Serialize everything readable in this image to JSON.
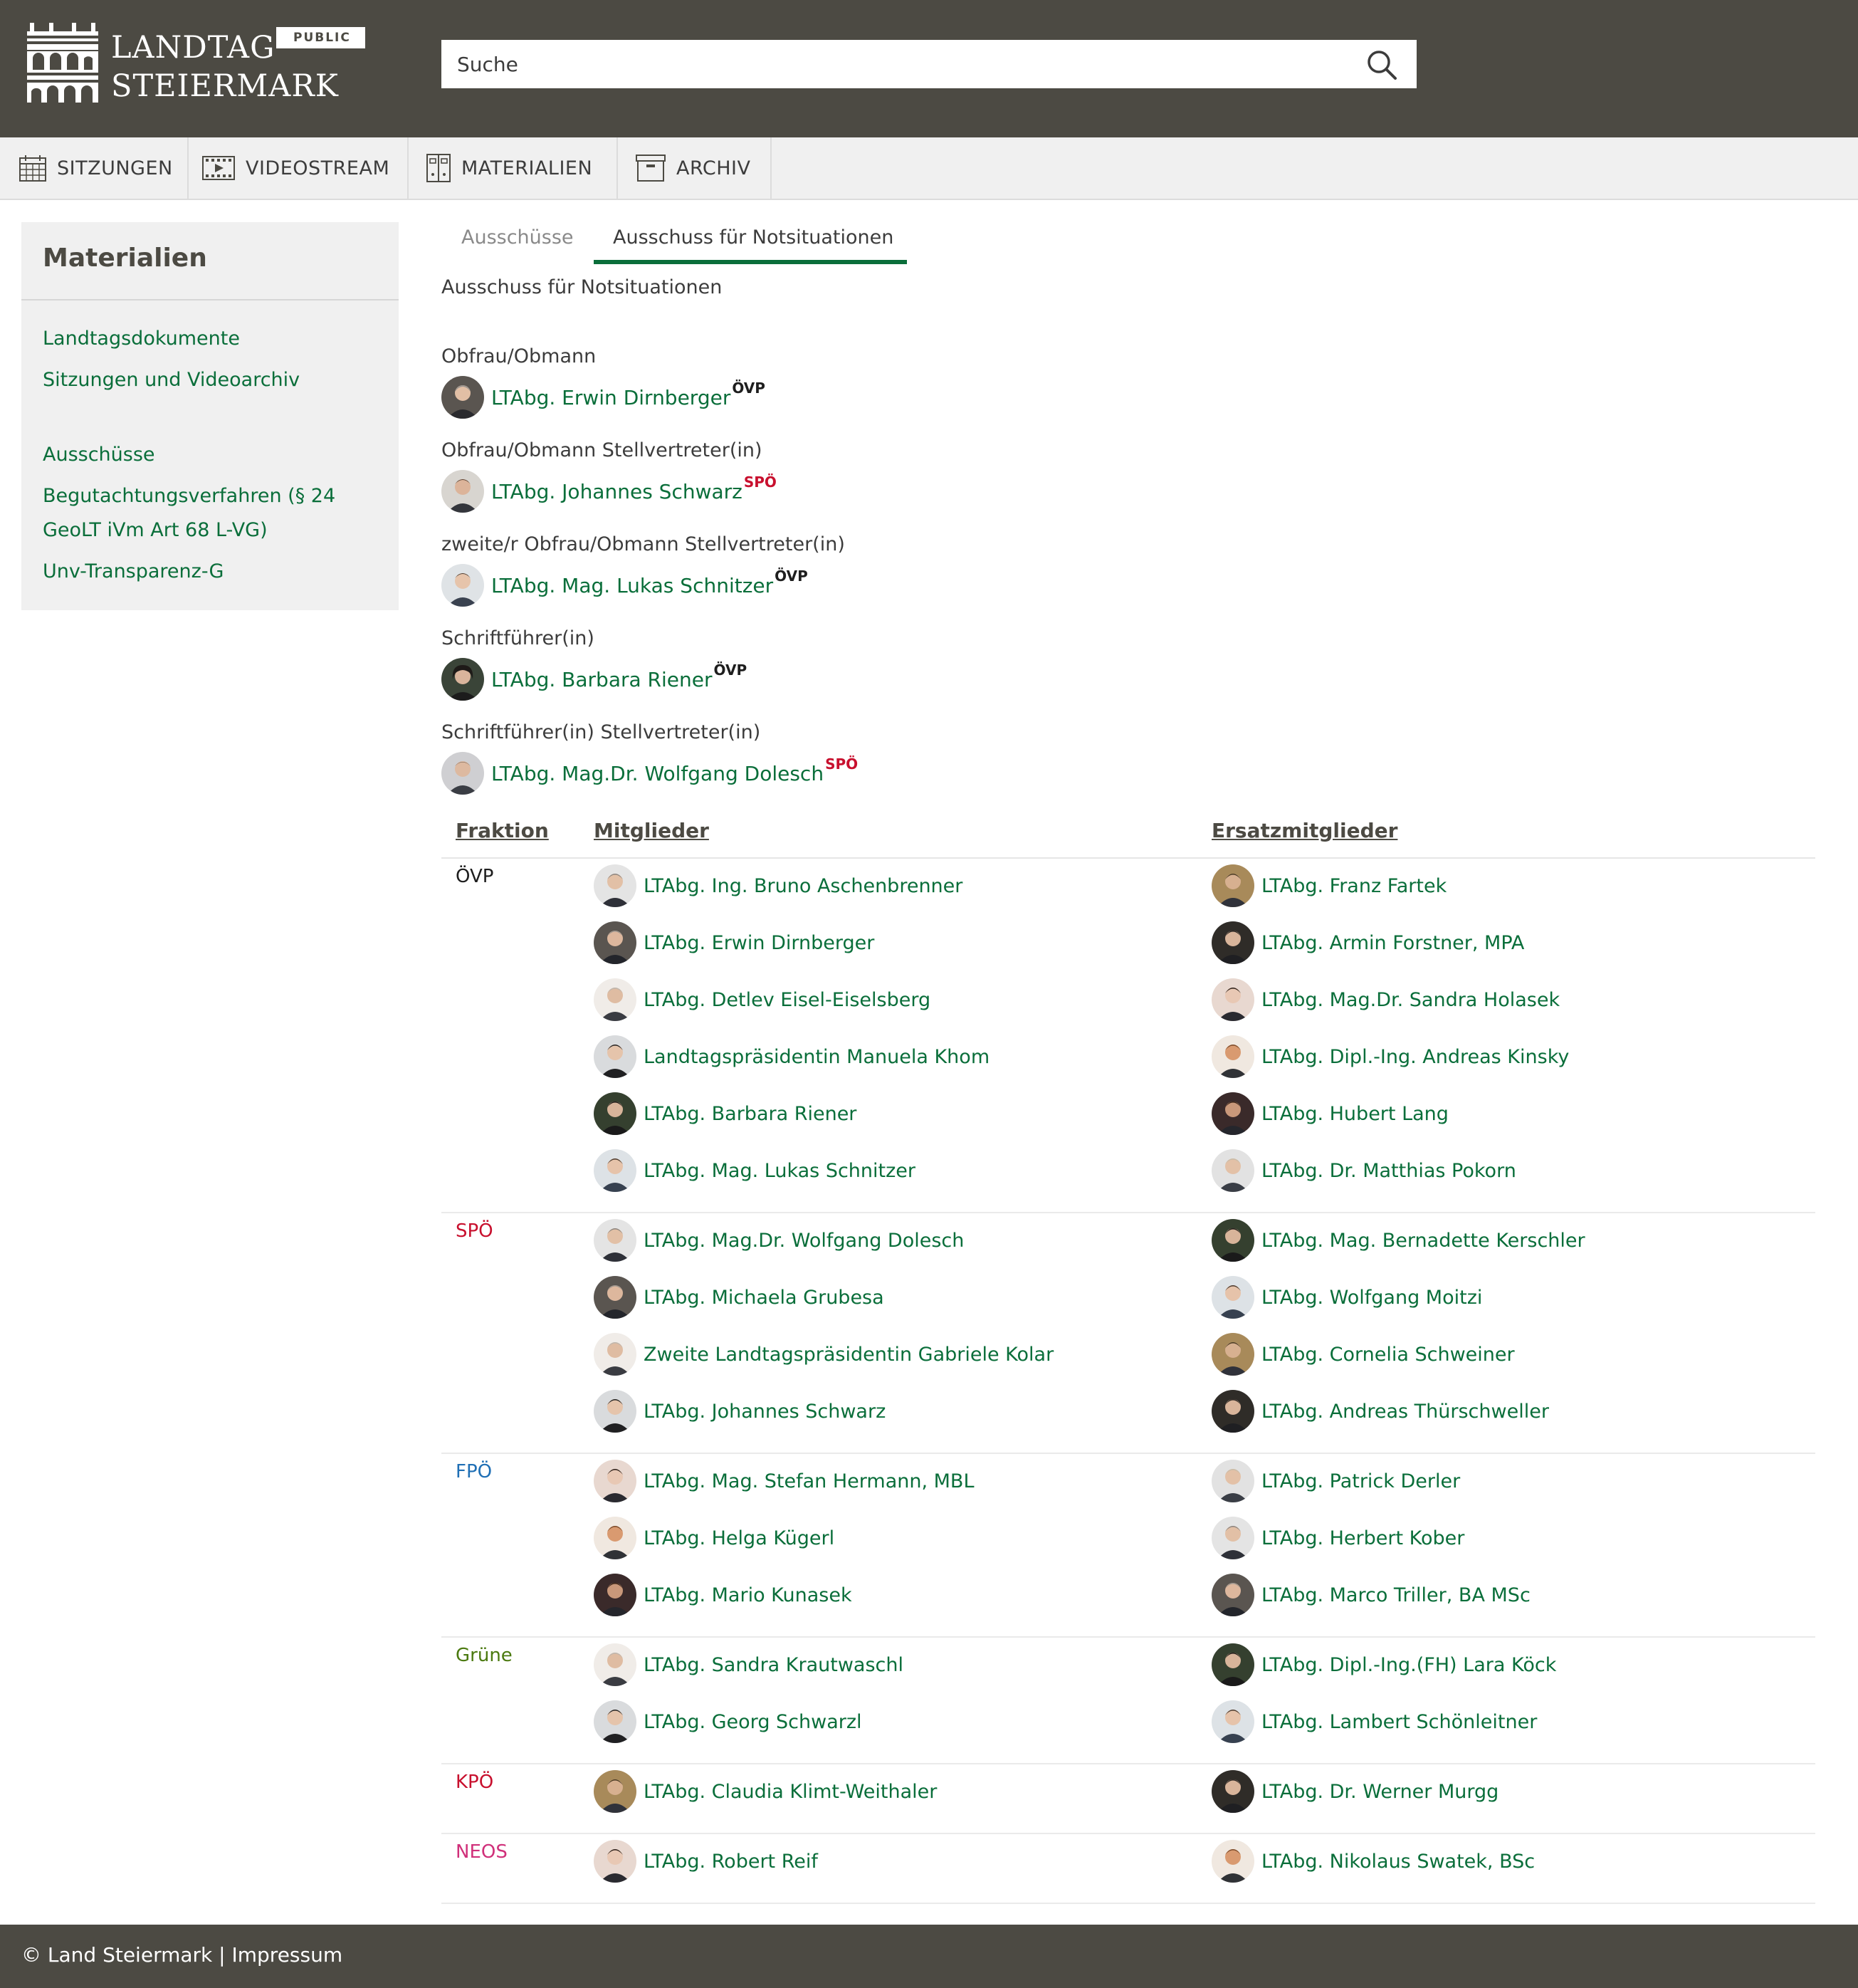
{
  "header": {
    "logo_line1": "LANDTAG",
    "logo_line2": "STEIERMARK",
    "badge": "PUBLIC",
    "search_placeholder": "Suche"
  },
  "nav": [
    {
      "label": "SITZUNGEN",
      "icon": "calendar-icon"
    },
    {
      "label": "VIDEOSTREAM",
      "icon": "video-icon"
    },
    {
      "label": "MATERIALIEN",
      "icon": "binder-icon"
    },
    {
      "label": "ARCHIV",
      "icon": "archive-box-icon"
    }
  ],
  "sidebar": {
    "title": "Materialien",
    "links": [
      "Landtagsdokumente",
      "Sitzungen und Videoarchiv",
      "Ausschüsse",
      "Begutachtungsverfahren (§ 24",
      "GeoLT iVm Art 68 L-VG)",
      "Unv-Transparenz-G"
    ]
  },
  "tabs": [
    "Ausschüsse",
    "Ausschuss für Notsituationen"
  ],
  "subtitle": "Ausschuss für Notsituationen",
  "roles": [
    {
      "role": "Obfrau/Obmann",
      "name": "LTAbg. Erwin Dirnberger",
      "party": "ÖVP"
    },
    {
      "role": "Obfrau/Obmann Stellvertreter(in)",
      "name": "LTAbg. Johannes Schwarz",
      "party": "SPÖ"
    },
    {
      "role": "zweite/r Obfrau/Obmann Stellvertreter(in)",
      "name": "LTAbg. Mag. Lukas Schnitzer",
      "party": "ÖVP"
    },
    {
      "role": "Schriftführer(in)",
      "name": "LTAbg. Barbara Riener",
      "party": "ÖVP"
    },
    {
      "role": "Schriftführer(in) Stellvertreter(in)",
      "name": "LTAbg. Mag.Dr. Wolfgang Dolesch",
      "party": "SPÖ"
    }
  ],
  "table": {
    "headers": [
      "Fraktion",
      "Mitglieder",
      "Ersatzmitglieder"
    ],
    "groups": [
      {
        "faction": "ÖVP",
        "members": [
          "LTAbg. Ing. Bruno Aschenbrenner",
          "LTAbg. Erwin Dirnberger",
          "LTAbg. Detlev Eisel-Eiselsberg",
          "Landtagspräsidentin Manuela Khom",
          "LTAbg. Barbara Riener",
          "LTAbg. Mag. Lukas Schnitzer"
        ],
        "substitutes": [
          "LTAbg. Franz Fartek",
          "LTAbg. Armin Forstner, MPA",
          "LTAbg. Mag.Dr. Sandra Holasek",
          "LTAbg. Dipl.-Ing. Andreas Kinsky",
          "LTAbg. Hubert Lang",
          "LTAbg. Dr. Matthias Pokorn"
        ]
      },
      {
        "faction": "SPÖ",
        "members": [
          "LTAbg. Mag.Dr. Wolfgang Dolesch",
          "LTAbg. Michaela Grubesa",
          "Zweite Landtagspräsidentin Gabriele Kolar",
          "LTAbg. Johannes Schwarz"
        ],
        "substitutes": [
          "LTAbg. Mag. Bernadette Kerschler",
          "LTAbg. Wolfgang Moitzi",
          "LTAbg. Cornelia Schweiner",
          "LTAbg. Andreas Thürschweller"
        ]
      },
      {
        "faction": "FPÖ",
        "members": [
          "LTAbg. Mag. Stefan Hermann, MBL",
          "LTAbg. Helga Kügerl",
          "LTAbg. Mario Kunasek"
        ],
        "substitutes": [
          "LTAbg. Patrick Derler",
          "LTAbg. Herbert Kober",
          "LTAbg. Marco Triller, BA MSc"
        ]
      },
      {
        "faction": "Grüne",
        "members": [
          "LTAbg. Sandra Krautwaschl",
          "LTAbg. Georg Schwarzl"
        ],
        "substitutes": [
          "LTAbg. Dipl.-Ing.(FH) Lara Köck",
          "LTAbg. Lambert Schönleitner"
        ]
      },
      {
        "faction": "KPÖ",
        "members": [
          "LTAbg. Claudia Klimt-Weithaler"
        ],
        "substitutes": [
          "LTAbg. Dr. Werner Murgg"
        ]
      },
      {
        "faction": "NEOS",
        "members": [
          "LTAbg. Robert Reif"
        ],
        "substitutes": [
          "LTAbg. Nikolaus Swatek, BSc"
        ]
      }
    ]
  },
  "party_colors": {
    "ÖVP": "#1e1e1e",
    "SPÖ": "#c8102e",
    "FPÖ": "#1f6fb5",
    "Grüne": "#4b7a10",
    "KPÖ": "#c8102e",
    "NEOS": "#d0307a"
  },
  "colors": {
    "header_bg": "#4c4a43",
    "link_green": "#0a6e3a",
    "nav_bg": "#f0f0f0"
  },
  "footer": {
    "copyright": "© Land Steiermark",
    "separator": "|",
    "impressum": "Impressum"
  }
}
